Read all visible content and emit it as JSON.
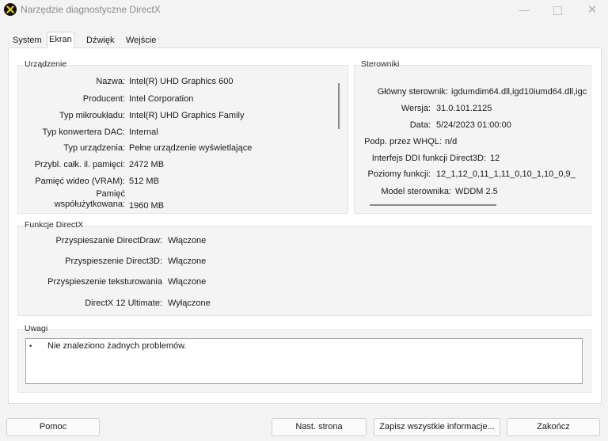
{
  "window": {
    "title": "Narzędzie diagnostyczne DirectX",
    "min": "—",
    "close": "✕"
  },
  "tabs": [
    "System",
    "Ekran",
    "Dźwięk",
    "Wejście"
  ],
  "device": {
    "title": "Urządzenie",
    "rows": [
      {
        "label": "Nazwa:",
        "value": "Intel(R) UHD Graphics 600"
      },
      {
        "label": "Producent:",
        "value": "Intel Corporation"
      },
      {
        "label": "Typ mikroukładu:",
        "value": "Intel(R) UHD Graphics Family"
      },
      {
        "label": "Typ konwertera DAC:",
        "value": "Internal"
      },
      {
        "label": "Typ urządzenia:",
        "value": "Pełne urządzenie wyświetlające"
      },
      {
        "label": "Przybl. całk. il. pamięci:",
        "value": "2472 MB"
      },
      {
        "label": "Pamięć wideo (VRAM):",
        "value": "512 MB"
      },
      {
        "label_line1": "Pamięć",
        "label_line2": "współużytkowana:",
        "value": "1960 MB"
      }
    ]
  },
  "drivers": {
    "title": "Sterowniki",
    "rows": [
      {
        "label": "Główny sterownik:",
        "value": "igdumdim64.dll,igd10iumd64.dll,igc"
      },
      {
        "label": "Wersja:",
        "value": "31.0.101.2125"
      },
      {
        "label": "Data:",
        "value": "5/24/2023 01:00:00"
      },
      {
        "label": "Podp. przez WHQL:",
        "value": "n/d"
      },
      {
        "label": "Interfejs DDI funkcji Direct3D:",
        "value": "12"
      },
      {
        "label": "Poziomy funkcji:",
        "value": "12_1,12_0,11_1,11_0,10_1,10_0,9_"
      },
      {
        "label": "Model sterownika:",
        "value": "WDDM 2.5"
      }
    ]
  },
  "directx": {
    "title": "Funkcje DirectX",
    "rows": [
      {
        "label": "Przyspieszanie DirectDraw:",
        "value": "Włączone"
      },
      {
        "label": "Przyspieszenie Direct3D:",
        "value": "Włączone"
      },
      {
        "label": "Przyspieszenie teksturowania",
        "value": "Włączone"
      },
      {
        "label": "DirectX 12 Ultimate:",
        "value": "Wyłączone"
      }
    ]
  },
  "notes": {
    "title": "Uwagi",
    "bullet": "•",
    "items": [
      "Nie znaleziono żadnych problemów."
    ]
  },
  "buttons": {
    "help": "Pomoc",
    "next_page": "Nast. strona",
    "save_all": "Zapisz wszystkie informacje...",
    "exit": "Zakończ"
  }
}
